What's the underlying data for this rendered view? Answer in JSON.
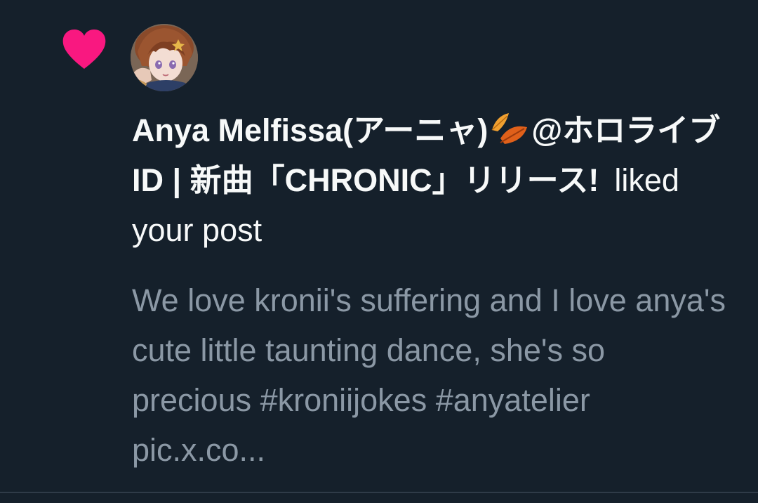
{
  "notification": {
    "type_icon": "heart-icon",
    "accent_color": "#f91880",
    "avatar_icon": "avatar-anime-girl",
    "actor_name_part1": "Anya Melfissa(アーニャ)",
    "actor_leaf_icon": "fallen-leaf-icon",
    "actor_name_part2": "@ホロライブID | 新曲「CHRONIC」リリース!",
    "action_text": "liked your post",
    "post_preview": "We love kronii's suffering and I love anya's cute little taunting dance, she's so precious #kroniijokes #anyatelier pic.x.co..."
  },
  "colors": {
    "background": "#15202b",
    "primary_text": "#f7f9f9",
    "secondary_text": "#8b98a5"
  }
}
